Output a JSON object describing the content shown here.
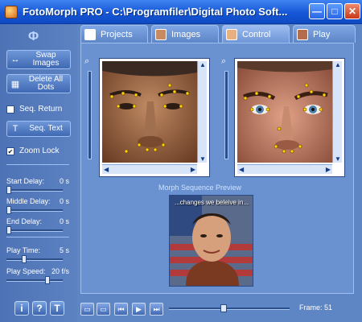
{
  "window": {
    "title": "FotoMorph PRO - C:\\Programfiler\\Digital Photo Soft...",
    "min": "—",
    "max": "□",
    "close": "✕"
  },
  "left": {
    "logo": "Φ",
    "swap_images": "Swap Images",
    "delete_dots": "Delete All Dots",
    "seq_return": "Seq. Return",
    "seq_text": "Seq. Text",
    "zoom_lock": "Zoom Lock",
    "start_delay": {
      "label": "Start Delay:",
      "value": "0 s",
      "level": 0.0
    },
    "middle_delay": {
      "label": "Middle Delay:",
      "value": "0 s",
      "level": 0.0
    },
    "end_delay": {
      "label": "End Delay:",
      "value": "0 s",
      "level": 0.0
    },
    "play_time": {
      "label": "Play Time:",
      "value": "5 s",
      "level": 0.3
    },
    "play_speed": {
      "label": "Play Speed:",
      "value": "20 f/s",
      "level": 0.75
    },
    "seq_return_checked": false,
    "zoom_lock_checked": true
  },
  "tabs": [
    {
      "label": "Projects",
      "active": false
    },
    {
      "label": "Images",
      "active": false
    },
    {
      "label": "Control",
      "active": true
    },
    {
      "label": "Play",
      "active": false
    }
  ],
  "preview": {
    "label": "Morph Sequence Preview",
    "caption": "...changes we beleive in..."
  },
  "bottom": {
    "info": "i",
    "help": "?",
    "text": "T",
    "frame_label": "Frame: 51",
    "frame_level": 0.45
  },
  "colors": {
    "accent": "#1657d8",
    "panel": "#5f86c4"
  }
}
